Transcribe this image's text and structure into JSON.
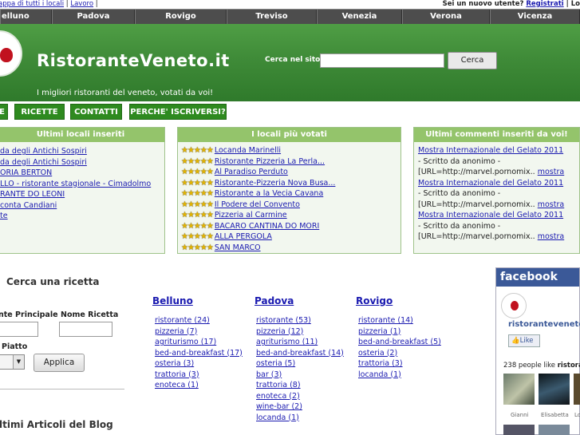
{
  "topbar": {
    "left_links": [
      "appa di tutti i locali",
      "Lavoro"
    ],
    "new_user_text": "Sei un nuovo utente?",
    "register_link": "Registrati",
    "suffix": "| Lo"
  },
  "cities": [
    "elluno",
    "Padova",
    "Rovigo",
    "Treviso",
    "Venezia",
    "Verona",
    "Vicenza"
  ],
  "header": {
    "site_name": "RistoranteVeneto.it",
    "tagline": "I migliori ristoranti del veneto, votati da voi!",
    "search_label": "Cerca nel sito:",
    "search_value": "",
    "search_button": "Cerca"
  },
  "menu": [
    "E",
    "RICETTE",
    "CONTATTI",
    "PERCHE' ISCRIVERSI?"
  ],
  "boxes": {
    "latest": {
      "title": "Ultimi locali inseriti",
      "items": [
        "da degli Antichi Sospiri",
        "da degli Antichi Sospiri",
        "ORIA BERTON",
        "LLO - ristorante stagionale - Cimadolmo",
        "RANTE DO LEONI",
        "conta Candiani",
        "te"
      ]
    },
    "voted": {
      "title": "I locali più votati",
      "stars": "★★★★★",
      "items": [
        "Locanda Marinelli",
        "Ristorante Pizzeria La Perla...",
        "Al Paradiso Perduto",
        "Ristorante-Pizzeria Nova Busa...",
        "Ristorante a la Vecia Cavana",
        "Il Podere del Convento",
        "Pizzeria al Carmine",
        "BACARO CANTINA DO MORI",
        "ALLA PERGOLA",
        "SAN MARCO"
      ]
    },
    "comments": {
      "title": "Ultimi commenti inseriti da voi!",
      "items": [
        {
          "link": "Mostra Internazionale del Gelato 2011",
          "author": "- Scritto da anonimo -",
          "text": "[URL=http://marvel.pornomix..",
          "more": "mostra"
        },
        {
          "link": "Mostra Internazionale del Gelato 2011",
          "author": "- Scritto da anonimo -",
          "text": "[URL=http://marvel.pornomix..",
          "more": "mostra"
        },
        {
          "link": "Mostra Internazionale del Gelato 2011",
          "author": "- Scritto da anonimo -",
          "text": "[URL=http://marvel.pornomix..",
          "more": "mostra"
        }
      ]
    }
  },
  "recipe": {
    "title": "Cerca una ricetta",
    "label_main": "nte Principale",
    "label_name": "Nome Ricetta",
    "label_dish": "Piatto",
    "apply": "Applica",
    "blog_title": "ltimi Articoli del Blog"
  },
  "regions": [
    {
      "name": "Belluno",
      "items": [
        "ristorante (24)",
        "pizzeria (7)",
        "agriturismo (17)",
        "bed-and-breakfast (17)",
        "osteria (3)",
        "trattoria (3)",
        "enoteca (1)"
      ]
    },
    {
      "name": "Padova",
      "items": [
        "ristorante (53)",
        "pizzeria (12)",
        "agriturismo (11)",
        "bed-and-breakfast (14)",
        "osteria (5)",
        "bar (3)",
        "trattoria (8)",
        "enoteca (2)",
        "wine-bar (2)",
        "locanda (1)"
      ]
    },
    {
      "name": "Rovigo",
      "items": [
        "ristorante (14)",
        "pizzeria (1)",
        "bed-and-breakfast (5)",
        "osteria (2)",
        "trattoria (3)",
        "locanda (1)"
      ]
    }
  ],
  "facebook": {
    "brand": "facebook",
    "page_name": "ristoranteveneto",
    "like": "Like",
    "people_like": "238 people like",
    "people_like_bold": "ristorante",
    "fans": [
      "Gianni",
      "Elisabetta",
      "Lo"
    ]
  },
  "colors": {
    "green": "#3f8b38",
    "menu": "#2e8a1f",
    "box_header": "#94c46b",
    "link": "#1a1ab0",
    "facebook": "#3b5998"
  }
}
